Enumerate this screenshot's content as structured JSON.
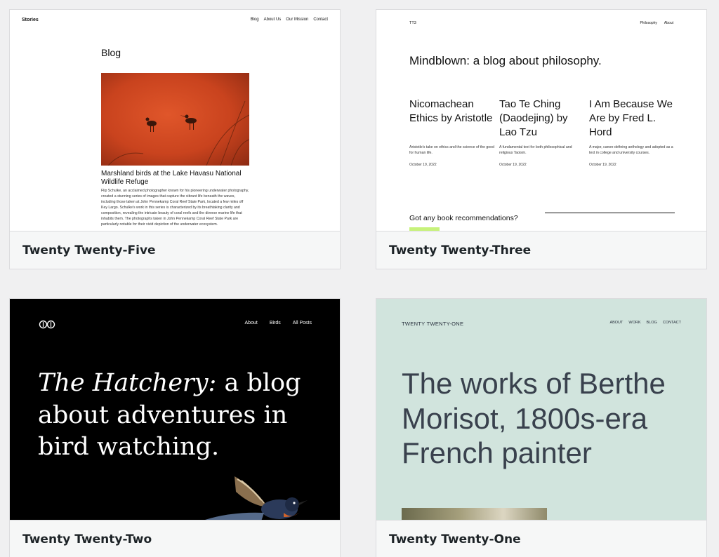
{
  "themes": [
    {
      "name": "Twenty Twenty-Five",
      "preview": {
        "site_title": "Stories",
        "nav": [
          "Blog",
          "About Us",
          "Our Mission",
          "Contact"
        ],
        "heading": "Blog",
        "post_title": "Marshland birds at the Lake Havasu National Wildlife Refuge",
        "post_excerpt": "Flip Schulke, an acclaimed photographer known for his pioneering underwater photography, created a stunning series of images that capture the vibrant life beneath the waves, including those taken at John Pennekamp Coral Reef State Park, located a few miles off Key Largo. Schulke's work in this series is characterized by its breathtaking clarity and composition, revealing the intricate beauty of coral reefs and the diverse marine life that inhabits them. The photographs taken in John Pennekamp Coral Reef State Park are particularly notable for their vivid depiction of the underwater ecosystem."
      }
    },
    {
      "name": "Twenty Twenty-Three",
      "preview": {
        "site_title": "TT3",
        "nav": [
          "Philosophy",
          "About"
        ],
        "heading": "Mindblown: a blog about philosophy.",
        "posts": [
          {
            "title": "Nicomachean Ethics by Aristotle",
            "excerpt": "Aristotle's take on ethics and the science of the good for human life.",
            "date": "October 19, 2022"
          },
          {
            "title": "Tao Te Ching (Daodejing) by Lao Tzu",
            "excerpt": "A fundamental text for both philosophical and religious Taoism.",
            "date": "October 19, 2022"
          },
          {
            "title": "I Am Because We Are by Fred L. Hord",
            "excerpt": "A major, canon-defining anthology and adopted as a text in college and university courses.",
            "date": "October 19, 2022"
          }
        ],
        "footer_prompt": "Got any book recommendations?"
      }
    },
    {
      "name": "Twenty Twenty-Two",
      "preview": {
        "nav": [
          "About",
          "Birds",
          "All Posts"
        ],
        "heading_italic": "The Hatchery:",
        "heading_rest": " a blog about adventures in bird watching."
      }
    },
    {
      "name": "Twenty Twenty-One",
      "preview": {
        "site_title": "TWENTY TWENTY-ONE",
        "nav": [
          "ABOUT",
          "WORK",
          "BLOG",
          "CONTACT"
        ],
        "heading": "The works of Berthe Morisot, 1800s-era French painter"
      }
    }
  ],
  "colors": {
    "tt5_image": "#d24b22",
    "tt3_accent": "#c7f27b",
    "tt2_background": "#000000",
    "tt1_background": "#d1e4dd"
  }
}
